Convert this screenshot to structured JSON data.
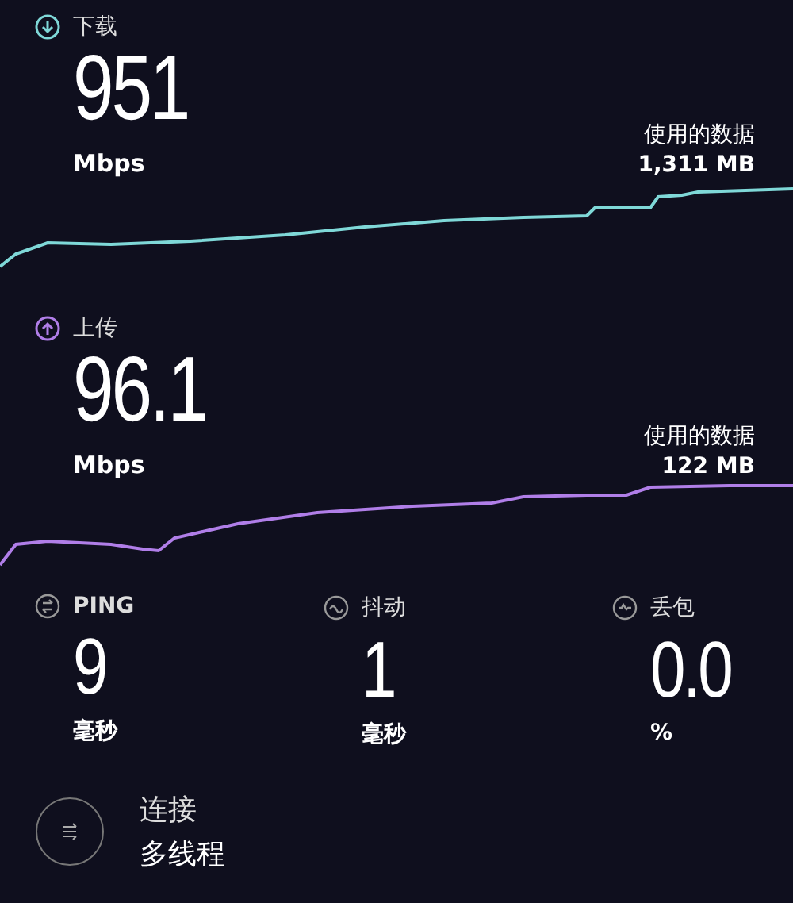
{
  "speeds": [
    {
      "kind": "download",
      "label": "下载",
      "value": "951",
      "unit": "Mbps",
      "data_label": "使用的数据",
      "data_value": "1,311 MB",
      "color": "#7fd8d8"
    },
    {
      "kind": "upload",
      "label": "上传",
      "value": "96.1",
      "unit": "Mbps",
      "data_label": "使用的数据",
      "data_value": "122 MB",
      "color": "#b07ee8"
    }
  ],
  "metrics": [
    {
      "kind": "ping",
      "label": "PING",
      "value": "9",
      "unit": "毫秒"
    },
    {
      "kind": "jitter",
      "label": "抖动",
      "value": "1",
      "unit": "毫秒"
    },
    {
      "kind": "loss",
      "label": "丢包",
      "value": "0.0",
      "unit": "%"
    }
  ],
  "connection": {
    "label": "连接",
    "value": "多线程"
  }
}
